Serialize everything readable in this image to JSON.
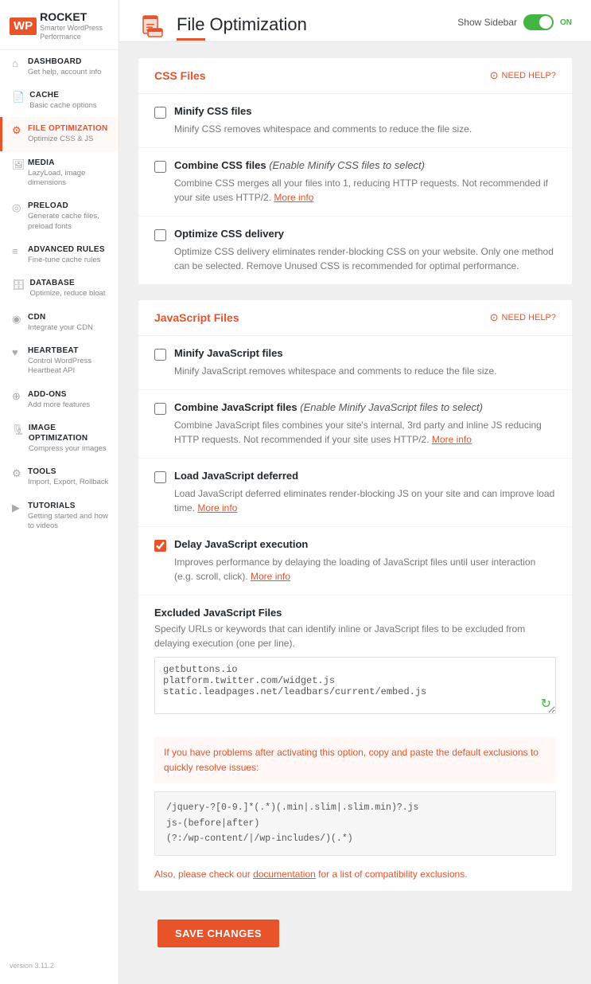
{
  "sidebar": {
    "logo": {
      "badge": "WP",
      "name": "ROCKET",
      "tagline": "Smarter WordPress Performance"
    },
    "items": [
      {
        "id": "dashboard",
        "title": "DASHBOARD",
        "sub": "Get help, account info",
        "icon": "🏠",
        "active": false
      },
      {
        "id": "cache",
        "title": "CACHE",
        "sub": "Basic cache options",
        "icon": "📄",
        "active": false
      },
      {
        "id": "file-optimization",
        "title": "FILE OPTIMIZATION",
        "sub": "Optimize CSS & JS",
        "icon": "🖼",
        "active": true
      },
      {
        "id": "media",
        "title": "MEDIA",
        "sub": "LazyLoad, image dimensions",
        "icon": "🖼",
        "active": false
      },
      {
        "id": "preload",
        "title": "PRELOAD",
        "sub": "Generate cache files, preload fonts",
        "icon": "⚙",
        "active": false
      },
      {
        "id": "advanced-rules",
        "title": "ADVANCED RULES",
        "sub": "Fine-tune cache rules",
        "icon": "≡",
        "active": false
      },
      {
        "id": "database",
        "title": "DATABASE",
        "sub": "Optimize, reduce bloat",
        "icon": "🗄",
        "active": false
      },
      {
        "id": "cdn",
        "title": "CDN",
        "sub": "Integrate your CDN",
        "icon": "🌐",
        "active": false
      },
      {
        "id": "heartbeat",
        "title": "HEARTBEAT",
        "sub": "Control WordPress Heartbeat API",
        "icon": "♥",
        "active": false
      },
      {
        "id": "add-ons",
        "title": "ADD-ONS",
        "sub": "Add more features",
        "icon": "👥",
        "active": false
      },
      {
        "id": "image-optimization",
        "title": "IMAGE OPTIMIZATION",
        "sub": "Compress your images",
        "icon": "🖼",
        "active": false
      },
      {
        "id": "tools",
        "title": "TOOLS",
        "sub": "Import, Export, Rollback",
        "icon": "⚙",
        "active": false
      },
      {
        "id": "tutorials",
        "title": "TUTORIALS",
        "sub": "Getting started and how to videos",
        "icon": "▶",
        "active": false
      }
    ],
    "version": "version 3.11.2"
  },
  "header": {
    "title": "File Optimization",
    "show_sidebar_label": "Show Sidebar",
    "toggle_state": "ON"
  },
  "css_section": {
    "title": "CSS Files",
    "need_help": "NEED HELP?",
    "options": [
      {
        "id": "minify-css",
        "label": "Minify CSS files",
        "checked": false,
        "desc": "Minify CSS removes whitespace and comments to reduce the file size."
      },
      {
        "id": "combine-css",
        "label": "Combine CSS files",
        "label_em": "(Enable Minify CSS files to select)",
        "checked": false,
        "desc": "Combine CSS merges all your files into 1, reducing HTTP requests. Not recommended if your site uses HTTP/2.",
        "link_text": "More info",
        "link_href": "#"
      },
      {
        "id": "optimize-css-delivery",
        "label": "Optimize CSS delivery",
        "checked": false,
        "desc": "Optimize CSS delivery eliminates render-blocking CSS on your website. Only one method can be selected. Remove Unused CSS is recommended for optimal performance."
      }
    ]
  },
  "js_section": {
    "title": "JavaScript Files",
    "need_help": "NEED HELP?",
    "options": [
      {
        "id": "minify-js",
        "label": "Minify JavaScript files",
        "checked": false,
        "desc": "Minify JavaScript removes whitespace and comments to reduce the file size."
      },
      {
        "id": "combine-js",
        "label": "Combine JavaScript files",
        "label_em": "(Enable Minify JavaScript files to select)",
        "checked": false,
        "desc": "Combine JavaScript files combines your site's internal, 3rd party and inline JS reducing HTTP requests. Not recommended if your site uses HTTP/2.",
        "link_text": "More info",
        "link_href": "#"
      },
      {
        "id": "load-js-deferred",
        "label": "Load JavaScript deferred",
        "checked": false,
        "desc": "Load JavaScript deferred eliminates render-blocking JS on your site and can improve load time.",
        "link_text": "More info",
        "link_href": "#"
      },
      {
        "id": "delay-js",
        "label": "Delay JavaScript execution",
        "checked": true,
        "desc": "Improves performance by delaying the loading of JavaScript files until user interaction (e.g. scroll, click).",
        "link_text": "More info",
        "link_href": "#"
      }
    ],
    "excluded": {
      "title": "Excluded JavaScript Files",
      "desc": "Specify URLs or keywords that can identify inline or JavaScript files to be excluded from delaying execution (one per line).",
      "value": "getbuttons.io\nplatform.twitter.com/widget.js\nstatic.leadpages.net/leadbars/current/embed.js"
    },
    "info_text_pre": "If you have problems after activating this option, copy and paste the default exclusions to quickly resolve issues:",
    "code_lines": [
      "/jquery-?[0-9.]*(.*)(.min|.slim|.slim.min)?.js",
      "js-(before|after)",
      "(?:/wp-content/|/wp-includes/)(.*)"
    ],
    "also_text_pre": "Also, please check our",
    "also_link": "documentation",
    "also_text_post": "for a list of compatibility exclusions."
  },
  "save_button_label": "SAVE CHANGES"
}
